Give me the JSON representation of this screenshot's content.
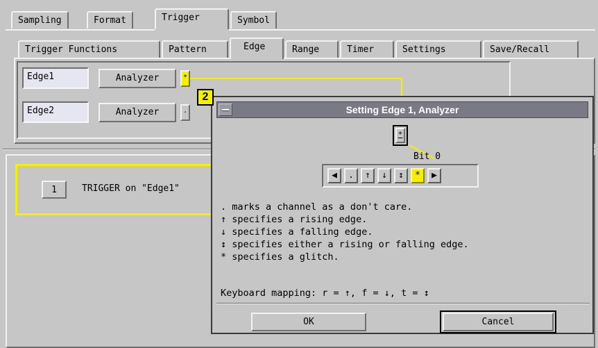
{
  "top_tabs": [
    "Sampling",
    "Format",
    "Trigger",
    "Symbol"
  ],
  "sub_tabs": [
    "Trigger Functions",
    "Pattern",
    "Edge",
    "Range",
    "Timer",
    "Settings",
    "Save/Recall"
  ],
  "edges": [
    {
      "name": "Edge1",
      "analyzer": "Analyzer",
      "value": "*"
    },
    {
      "name": "Edge2",
      "analyzer": "Analyzer",
      "value": "."
    }
  ],
  "sequence": {
    "step_number": "1",
    "text": "TRIGGER on \"Edge1\""
  },
  "callout": "2",
  "dialog": {
    "title": "Setting Edge 1, Analyzer",
    "current_value": "*",
    "bit_label": "Bit 0",
    "buttons": [
      "◀",
      ".",
      "↑",
      "↓",
      "↕",
      "*",
      "▶"
    ],
    "selected_index": 5,
    "descriptions": [
      ". marks a channel as a don't care.",
      "↑ specifies a rising edge.",
      "↓ specifies a falling edge.",
      "↕ specifies either a rising or falling edge.",
      "* specifies a glitch."
    ],
    "keyboard_mapping": "Keyboard mapping: r = ↑, f = ↓, t = ↕",
    "ok_label": "OK",
    "cancel_label": "Cancel"
  },
  "colors": {
    "highlight_yellow": "#f4f000",
    "window_gray": "#c6c6c6",
    "titlebar": "#7a7a84"
  }
}
